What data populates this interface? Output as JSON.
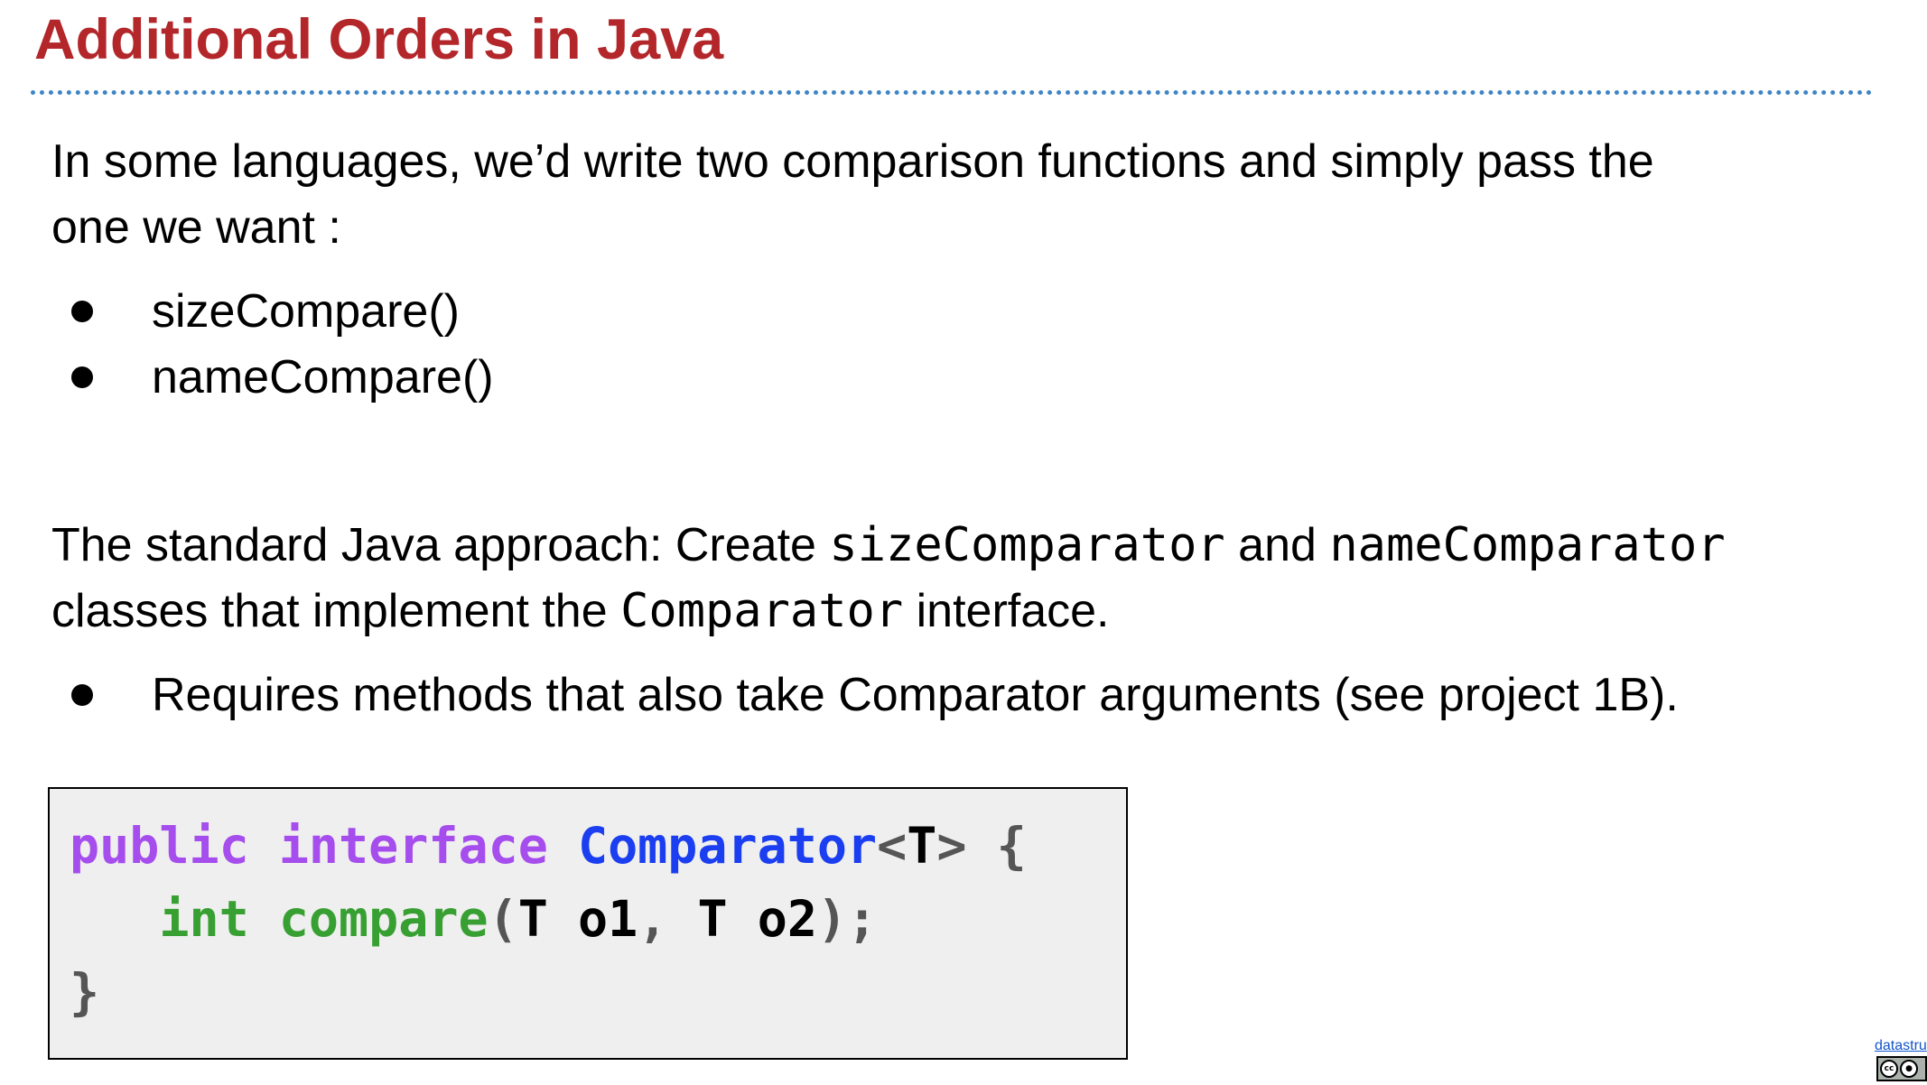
{
  "slide": {
    "title": "Additional Orders in Java",
    "paragraph1": "In some languages, we’d write two comparison functions and simply pass the",
    "paragraph1_cont": "one we want :",
    "bullets1": [
      "sizeCompare()",
      "nameCompare()"
    ],
    "paragraph2": {
      "t1": "The standard Java approach: Create ",
      "c1": "sizeComparator",
      "t2": " and ",
      "c2": "nameComparator",
      "t3": "classes that implement the ",
      "c3": "Comparator",
      "t4": " interface."
    },
    "bullets2": [
      "Requires methods that also take Comparator arguments (see project 1B)."
    ]
  },
  "code": {
    "line1": {
      "public": "public",
      "interface": "interface",
      "name": "Comparator",
      "lt": "<",
      "T": "T",
      "gt": ">",
      "brace": "{"
    },
    "line2": {
      "int": "int",
      "compare": "compare",
      "lparen": "(",
      "T1": "T",
      "o1": "o1",
      "comma": ",",
      "T2": "T",
      "o2": "o2",
      "rparen": ")",
      "semi": ";"
    },
    "line3": {
      "brace": "}"
    }
  },
  "footer": {
    "link_text": "datastru",
    "license_icons": [
      "cc-icon",
      "by-icon"
    ]
  },
  "colors": {
    "title": "#b3262a",
    "rule": "#3d85c6",
    "keyword_purple": "#a64ded",
    "type_blue": "#1a3ef0",
    "keyword_green": "#38a032",
    "code_bg": "#efefef"
  }
}
